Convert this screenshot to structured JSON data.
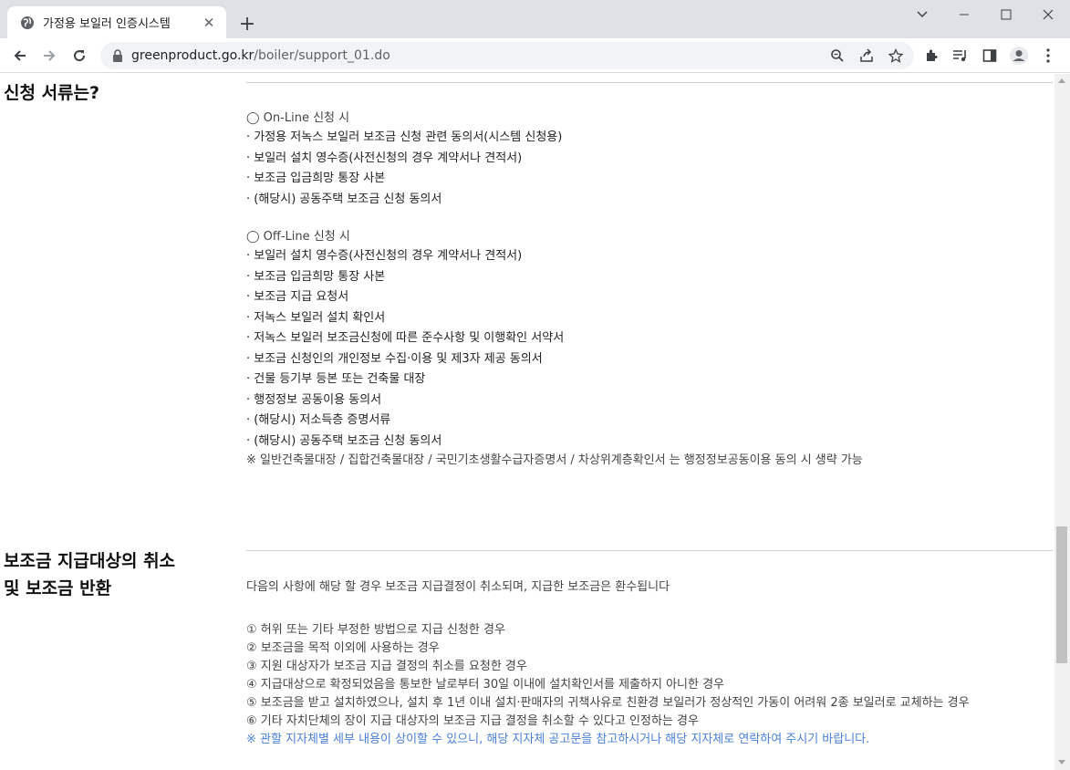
{
  "browser": {
    "tab_title": "가정용 보일러 인증시스템",
    "url_domain": "greenproduct.go.kr",
    "url_path": "/boiler/support_01.do"
  },
  "section1": {
    "title": "신청 서류는?",
    "online_header": "◯ On-Line 신청 시",
    "online_items": [
      "· 가정용 저녹스 보일러 보조금 신청 관련 동의서(시스템 신청용)",
      "· 보일러 설치 영수증(사전신청의 경우 계약서나 견적서)",
      "· 보조금 입금희망 통장 사본",
      "· (해당시) 공동주택 보조금 신청 동의서"
    ],
    "offline_header": "◯ Off-Line 신청 시",
    "offline_items": [
      "· 보일러 설치 영수증(사전신청의 경우 계약서나 견적서)",
      "· 보조금 입금희망 통장 사본",
      "· 보조금 지급 요청서",
      "· 저녹스 보일러 설치 확인서",
      "· 저녹스 보일러 보조금신청에 따른 준수사항 및 이행확인 서약서",
      "· 보조금 신청인의 개인정보 수집·이용 및 제3자 제공 동의서",
      "· 건물 등기부 등본 또는 건축물 대장",
      "· 행정정보 공동이용 동의서",
      "· (해당시) 저소득층 증명서류",
      "· (해당시) 공동주택 보조금 신청 동의서"
    ],
    "note": "※ 일반건축물대장 / 집합건축물대장 / 국민기초생활수급자증명서 / 차상위계층확인서 는 행정정보공동이용 동의 시 생략 가능"
  },
  "section2": {
    "title_line1": "보조금 지급대상의 취소",
    "title_line2": "및 보조금 반환",
    "intro": "다음의 사항에 해당 할 경우 보조금 지급결정이 취소되며, 지급한 보조금은 환수됩니다",
    "items": [
      "① 허위 또는 기타 부정한 방법으로 지급 신청한 경우",
      "② 보조금을 목적 이외에 사용하는 경우",
      "③ 지원 대상자가 보조금 지급 결정의 취소를 요청한 경우",
      "④ 지급대상으로 확정되었음을 통보한 날로부터 30일 이내에 설치확인서를 제출하지 아니한 경우",
      "⑤ 보조금을 받고 설치하였으나, 설치 후 1년 이내 설치·판매자의 귀책사유로 친환경 보일러가 정상적인 가동이 어려워 2종 보일러로 교체하는 경우",
      "⑥ 기타 자치단체의 장이 지급 대상자의 보조금 지급 결정을 취소할 수 있다고 인정하는 경우"
    ],
    "notice": "※ 관할 지자체별 세부 내용이 상이할 수 있으니, 해당 지자체 공고문을 참고하시거나 해당 지자체로 연락하여 주시기 바랍니다."
  }
}
